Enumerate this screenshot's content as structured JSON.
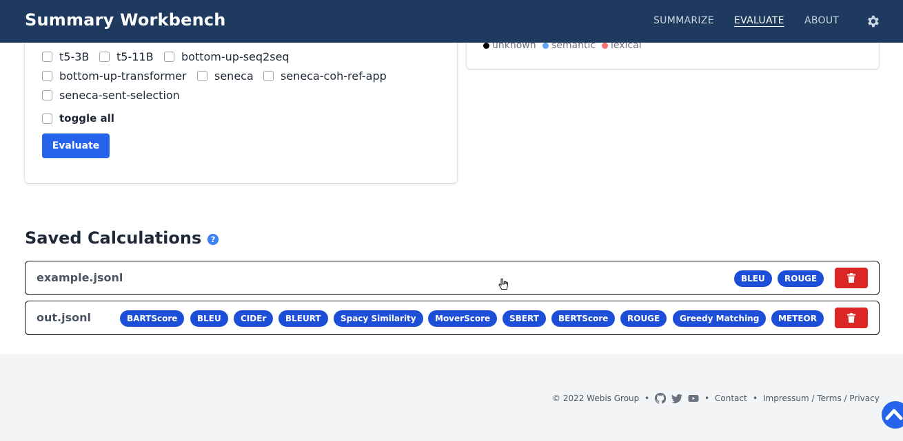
{
  "header": {
    "title": "Summary Workbench",
    "nav": [
      "SUMMARIZE",
      "EVALUATE",
      "ABOUT"
    ],
    "active_nav": "EVALUATE"
  },
  "models": {
    "items": [
      "t5-3B",
      "t5-11B",
      "bottom-up-seq2seq",
      "bottom-up-transformer",
      "seneca",
      "seneca-coh-ref-app",
      "seneca-sent-selection"
    ],
    "toggle_all": "toggle all",
    "evaluate_button": "Evaluate"
  },
  "legend": {
    "items": [
      {
        "label": "unknown",
        "color": "#000000"
      },
      {
        "label": "semantic",
        "color": "#60a5fa"
      },
      {
        "label": "lexical",
        "color": "#f87171"
      }
    ]
  },
  "saved": {
    "title": "Saved Calculations",
    "rows": [
      {
        "name": "example.jsonl",
        "metrics": [
          "BLEU",
          "ROUGE"
        ]
      },
      {
        "name": "out.jsonl",
        "metrics": [
          "BARTScore",
          "BLEU",
          "CIDEr",
          "BLEURT",
          "Spacy Similarity",
          "MoverScore",
          "SBERT",
          "BERTScore",
          "ROUGE",
          "Greedy Matching",
          "METEOR"
        ]
      }
    ]
  },
  "footer": {
    "copyright": "© 2022 Webis Group",
    "sep": "•",
    "contact": "Contact",
    "impressum": "Impressum / Terms / Privacy"
  },
  "colors": {
    "navbar": "#1e3a5f",
    "accent": "#2563eb",
    "badge": "#1d4ed8",
    "danger": "#dc2626"
  }
}
